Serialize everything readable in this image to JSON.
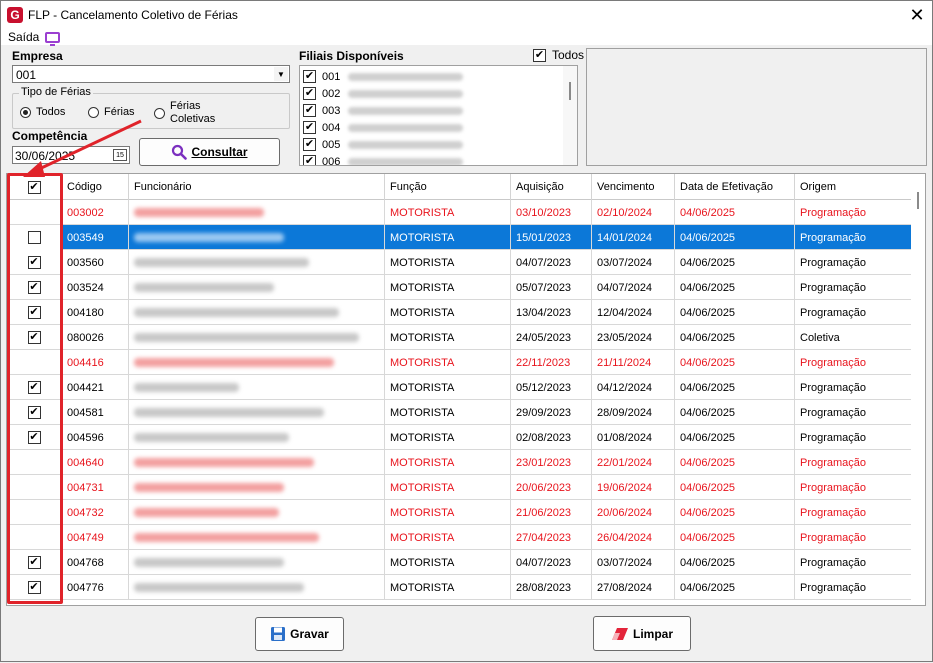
{
  "window": {
    "title": "FLP - Cancelamento Coletivo de Férias",
    "close_icon": "✕"
  },
  "menu": {
    "saida_label": "Saída"
  },
  "empresa": {
    "label": "Empresa",
    "value": "001"
  },
  "tipo_ferias": {
    "legend": "Tipo de Férias",
    "options": [
      {
        "label": "Todos",
        "selected": true
      },
      {
        "label": "Férias",
        "selected": false
      },
      {
        "label": "Férias Coletivas",
        "line1": "Férias",
        "line2": "Coletivas",
        "selected": false
      }
    ]
  },
  "competencia": {
    "label": "Competência",
    "value": "30/06/2025",
    "cal_text": "15"
  },
  "consultar_label": "Consultar",
  "filiais": {
    "label": "Filiais Disponíveis",
    "todos_label": "Todos",
    "todos_checked": true,
    "items": [
      {
        "code": "001",
        "checked": true
      },
      {
        "code": "002",
        "checked": true
      },
      {
        "code": "003",
        "checked": true
      },
      {
        "code": "004",
        "checked": true
      },
      {
        "code": "005",
        "checked": true
      },
      {
        "code": "006",
        "checked": true
      }
    ]
  },
  "grid": {
    "headers": [
      "Código",
      "Funcionário",
      "Função",
      "Aquisição",
      "Vencimento",
      "Data de Efetivação",
      "Origem"
    ],
    "header_checked": true,
    "rows": [
      {
        "checked": false,
        "red": true,
        "selected": false,
        "codigo": "003002",
        "funcao": "MOTORISTA",
        "aquisicao": "03/10/2023",
        "vencimento": "02/10/2024",
        "efetivacao": "04/06/2025",
        "origem": "Programação"
      },
      {
        "checked": true,
        "red": false,
        "selected": true,
        "codigo": "003549",
        "funcao": "MOTORISTA",
        "aquisicao": "15/01/2023",
        "vencimento": "14/01/2024",
        "efetivacao": "04/06/2025",
        "origem": "Programação"
      },
      {
        "checked": true,
        "red": false,
        "selected": false,
        "codigo": "003560",
        "funcao": "MOTORISTA",
        "aquisicao": "04/07/2023",
        "vencimento": "03/07/2024",
        "efetivacao": "04/06/2025",
        "origem": "Programação"
      },
      {
        "checked": true,
        "red": false,
        "selected": false,
        "codigo": "003524",
        "funcao": "MOTORISTA",
        "aquisicao": "05/07/2023",
        "vencimento": "04/07/2024",
        "efetivacao": "04/06/2025",
        "origem": "Programação"
      },
      {
        "checked": true,
        "red": false,
        "selected": false,
        "codigo": "004180",
        "funcao": "MOTORISTA",
        "aquisicao": "13/04/2023",
        "vencimento": "12/04/2024",
        "efetivacao": "04/06/2025",
        "origem": "Programação"
      },
      {
        "checked": true,
        "red": false,
        "selected": false,
        "codigo": "080026",
        "funcao": "MOTORISTA",
        "aquisicao": "24/05/2023",
        "vencimento": "23/05/2024",
        "efetivacao": "04/06/2025",
        "origem": "Coletiva"
      },
      {
        "checked": false,
        "red": true,
        "selected": false,
        "codigo": "004416",
        "funcao": "MOTORISTA",
        "aquisicao": "22/11/2023",
        "vencimento": "21/11/2024",
        "efetivacao": "04/06/2025",
        "origem": "Programação"
      },
      {
        "checked": true,
        "red": false,
        "selected": false,
        "codigo": "004421",
        "funcao": "MOTORISTA",
        "aquisicao": "05/12/2023",
        "vencimento": "04/12/2024",
        "efetivacao": "04/06/2025",
        "origem": "Programação"
      },
      {
        "checked": true,
        "red": false,
        "selected": false,
        "codigo": "004581",
        "funcao": "MOTORISTA",
        "aquisicao": "29/09/2023",
        "vencimento": "28/09/2024",
        "efetivacao": "04/06/2025",
        "origem": "Programação"
      },
      {
        "checked": true,
        "red": false,
        "selected": false,
        "codigo": "004596",
        "funcao": "MOTORISTA",
        "aquisicao": "02/08/2023",
        "vencimento": "01/08/2024",
        "efetivacao": "04/06/2025",
        "origem": "Programação"
      },
      {
        "checked": false,
        "red": true,
        "selected": false,
        "codigo": "004640",
        "funcao": "MOTORISTA",
        "aquisicao": "23/01/2023",
        "vencimento": "22/01/2024",
        "efetivacao": "04/06/2025",
        "origem": "Programação"
      },
      {
        "checked": false,
        "red": true,
        "selected": false,
        "codigo": "004731",
        "funcao": "MOTORISTA",
        "aquisicao": "20/06/2023",
        "vencimento": "19/06/2024",
        "efetivacao": "04/06/2025",
        "origem": "Programação"
      },
      {
        "checked": false,
        "red": true,
        "selected": false,
        "codigo": "004732",
        "funcao": "MOTORISTA",
        "aquisicao": "21/06/2023",
        "vencimento": "20/06/2024",
        "efetivacao": "04/06/2025",
        "origem": "Programação"
      },
      {
        "checked": false,
        "red": true,
        "selected": false,
        "codigo": "004749",
        "funcao": "MOTORISTA",
        "aquisicao": "27/04/2023",
        "vencimento": "26/04/2024",
        "efetivacao": "04/06/2025",
        "origem": "Programação"
      },
      {
        "checked": true,
        "red": false,
        "selected": false,
        "codigo": "004768",
        "funcao": "MOTORISTA",
        "aquisicao": "04/07/2023",
        "vencimento": "03/07/2024",
        "efetivacao": "04/06/2025",
        "origem": "Programação"
      },
      {
        "checked": true,
        "red": false,
        "selected": false,
        "codigo": "004776",
        "funcao": "MOTORISTA",
        "aquisicao": "28/08/2023",
        "vencimento": "27/08/2024",
        "efetivacao": "04/06/2025",
        "origem": "Programação"
      }
    ]
  },
  "buttons": {
    "gravar_label": "Gravar",
    "limpar_label": "Limpar"
  },
  "colors": {
    "selection": "#0c78d8",
    "red_text": "#e8141d",
    "annotation": "#e0232a"
  }
}
